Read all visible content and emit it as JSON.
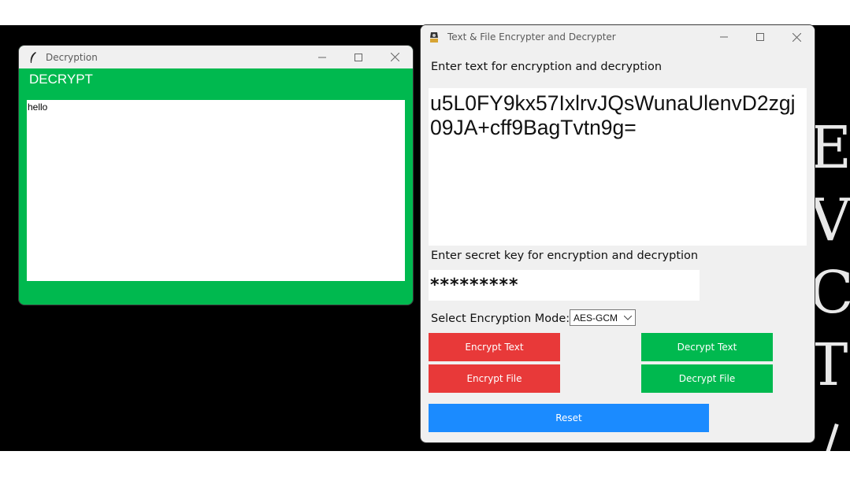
{
  "decrypt_window": {
    "title": "Decryption",
    "heading": "DECRYPT",
    "output_text": "hello"
  },
  "main_window": {
    "title": "Text & File Encrypter and Decrypter",
    "text_label": "Enter text for encryption and decryption",
    "text_value": "u5L0FY9kx57IxlrvJQsWunaUlenvD2zgj09JA+cff9BagTvtn9g=",
    "key_label": "Enter secret key for encryption and decryption",
    "key_value": "*********",
    "mode_label": "Select Encryption Mode:",
    "mode_selected": "AES-GCM",
    "buttons": {
      "encrypt_text": "Encrypt Text",
      "decrypt_text": "Decrypt Text",
      "encrypt_file": "Encrypt File",
      "decrypt_file": "Decrypt File",
      "reset": "Reset"
    }
  },
  "background_letters": [
    "E",
    "V",
    "C",
    "T"
  ],
  "colors": {
    "green": "#00b94f",
    "red": "#e83939",
    "blue": "#1b8bff"
  }
}
